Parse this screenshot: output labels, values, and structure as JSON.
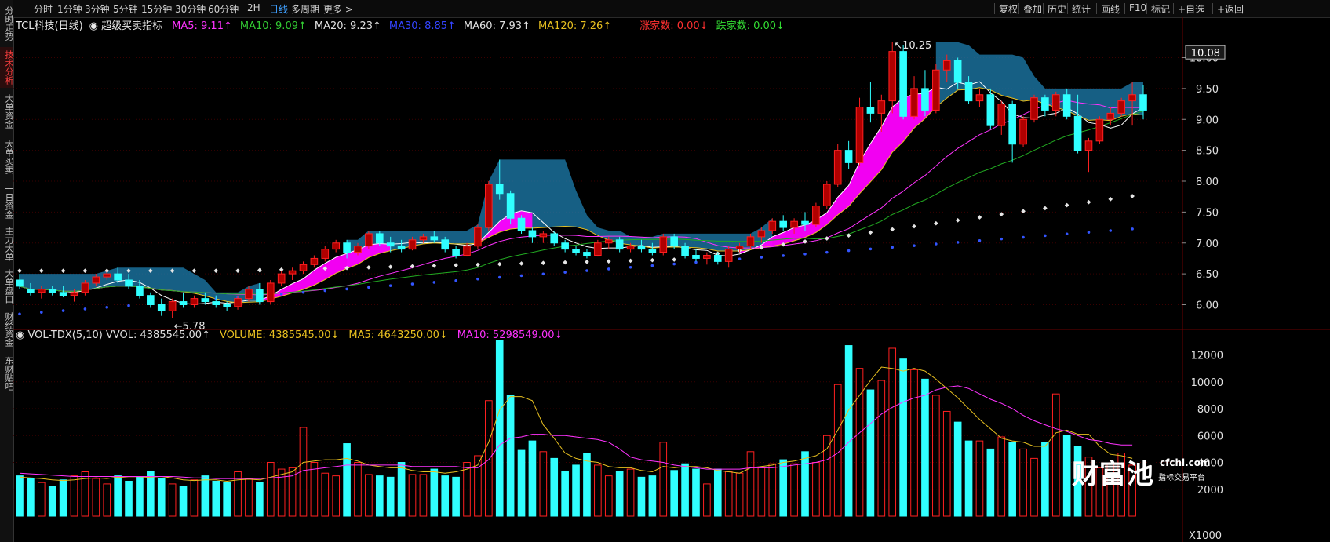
{
  "left_tabs": [
    {
      "label": "分时走势",
      "active": false
    },
    {
      "label": "技术分析",
      "active": true
    },
    {
      "label": "大单资金",
      "active": false
    },
    {
      "label": "大单买卖",
      "active": false
    },
    {
      "label": "一日资金",
      "active": false
    },
    {
      "label": "主力大单",
      "active": false
    },
    {
      "label": "大单盘口",
      "active": false
    },
    {
      "label": "财经资金",
      "active": false
    },
    {
      "label": "东财贴吧",
      "active": false
    }
  ],
  "periods": [
    "分时",
    "1分钟",
    "3分钟",
    "5分钟",
    "15分钟",
    "30分钟",
    "60分钟",
    "2H",
    "日线",
    "多周期",
    "更多 >"
  ],
  "active_period": "日线",
  "tools": [
    "复权",
    "叠加",
    "历史",
    "统计",
    "画线",
    "F10",
    "标记",
    "+自选",
    "+返回"
  ],
  "main_legend": {
    "title": "TCL科技(日线)",
    "indicator": "超级买卖指标",
    "items": [
      {
        "text": "MA5: 9.11↑",
        "color": "#ff33ff"
      },
      {
        "text": "MA10: 9.09↑",
        "color": "#33cc33"
      },
      {
        "text": "MA20: 9.23↑",
        "color": "#e0e0e0"
      },
      {
        "text": "MA30: 8.85↑",
        "color": "#3344ff"
      },
      {
        "text": "MA60: 7.93↑",
        "color": "#e0e0e0"
      },
      {
        "text": "MA120: 7.26↑",
        "color": "#e8c020"
      },
      {
        "text": "涨家数: 0.00↓",
        "color": "#ff3030"
      },
      {
        "text": "跌家数: 0.00↓",
        "color": "#33dd33"
      }
    ]
  },
  "vol_legend": {
    "items": [
      {
        "text": "VOL-TDX(5,10) VVOL: 4385545.00↑",
        "color": "#e0e0e0"
      },
      {
        "text": "VOLUME: 4385545.00↓",
        "color": "#e8c020"
      },
      {
        "text": "MA5: 4643250.00↓",
        "color": "#e8c020"
      },
      {
        "text": "MA10: 5298549.00↓",
        "color": "#ff33ff"
      }
    ]
  },
  "price_axis": {
    "ticks": [
      "10.00",
      "9.50",
      "9.00",
      "8.50",
      "8.00",
      "7.50",
      "7.00",
      "6.50",
      "6.00"
    ],
    "current": "10.08"
  },
  "vol_axis": {
    "ticks": [
      "12000",
      "10000",
      "8000",
      "6000",
      "4000",
      "2000"
    ],
    "unit": "X1000"
  },
  "watermark": {
    "main": "财富池",
    "domain": "cfchi.com",
    "sub": "指标交易平台"
  },
  "colors": {
    "up": "#ff2020",
    "down": "#30ffff",
    "bg": "#000000",
    "grid": "#3a0000",
    "cloud": "#1e7fb0",
    "band": "#ff00ff"
  },
  "chart_data": {
    "type": "candlestick",
    "ylim": [
      5.6,
      10.4
    ],
    "vol_ylim": [
      0,
      13200
    ],
    "high_label": "10.25",
    "low_label": "5.78",
    "candles": [
      [
        6.4,
        6.5,
        6.25,
        6.3
      ],
      [
        6.25,
        6.35,
        6.15,
        6.2
      ],
      [
        6.2,
        6.3,
        6.1,
        6.25
      ],
      [
        6.25,
        6.3,
        6.15,
        6.2
      ],
      [
        6.2,
        6.3,
        6.12,
        6.15
      ],
      [
        6.15,
        6.25,
        6.05,
        6.2
      ],
      [
        6.2,
        6.4,
        6.15,
        6.35
      ],
      [
        6.35,
        6.5,
        6.3,
        6.45
      ],
      [
        6.45,
        6.55,
        6.4,
        6.5
      ],
      [
        6.5,
        6.6,
        6.35,
        6.4
      ],
      [
        6.4,
        6.5,
        6.25,
        6.3
      ],
      [
        6.3,
        6.4,
        6.1,
        6.15
      ],
      [
        6.15,
        6.2,
        5.95,
        6.0
      ],
      [
        6.0,
        6.1,
        5.82,
        5.9
      ],
      [
        5.9,
        6.1,
        5.78,
        6.05
      ],
      [
        6.05,
        6.2,
        5.95,
        6.0
      ],
      [
        6.0,
        6.15,
        5.95,
        6.1
      ],
      [
        6.1,
        6.2,
        6.0,
        6.05
      ],
      [
        6.05,
        6.15,
        5.95,
        6.0
      ],
      [
        6.0,
        6.05,
        5.9,
        5.97
      ],
      [
        5.97,
        6.15,
        5.92,
        6.1
      ],
      [
        6.1,
        6.3,
        6.05,
        6.25
      ],
      [
        6.25,
        6.35,
        6.0,
        6.05
      ],
      [
        6.05,
        6.4,
        6.0,
        6.35
      ],
      [
        6.35,
        6.55,
        6.3,
        6.5
      ],
      [
        6.5,
        6.6,
        6.4,
        6.55
      ],
      [
        6.55,
        6.7,
        6.5,
        6.65
      ],
      [
        6.65,
        6.8,
        6.6,
        6.75
      ],
      [
        6.75,
        6.95,
        6.7,
        6.9
      ],
      [
        6.9,
        7.05,
        6.85,
        7.0
      ],
      [
        7.0,
        7.05,
        6.75,
        6.85
      ],
      [
        6.85,
        7.0,
        6.8,
        6.95
      ],
      [
        6.95,
        7.2,
        6.9,
        7.15
      ],
      [
        7.15,
        7.2,
        6.95,
        7.0
      ],
      [
        7.0,
        7.1,
        6.85,
        6.95
      ],
      [
        6.95,
        7.05,
        6.85,
        6.9
      ],
      [
        6.9,
        7.1,
        6.88,
        7.05
      ],
      [
        7.05,
        7.15,
        7.0,
        7.1
      ],
      [
        7.1,
        7.2,
        7.0,
        7.05
      ],
      [
        7.05,
        7.1,
        6.85,
        6.9
      ],
      [
        6.9,
        6.95,
        6.75,
        6.8
      ],
      [
        6.8,
        7.0,
        6.78,
        6.95
      ],
      [
        6.95,
        7.3,
        6.9,
        7.25
      ],
      [
        7.25,
        8.0,
        7.2,
        7.95
      ],
      [
        7.95,
        8.35,
        7.7,
        7.8
      ],
      [
        7.8,
        7.85,
        7.3,
        7.4
      ],
      [
        7.4,
        7.45,
        7.15,
        7.2
      ],
      [
        7.2,
        7.25,
        7.0,
        7.1
      ],
      [
        7.1,
        7.2,
        7.0,
        7.15
      ],
      [
        7.15,
        7.2,
        6.95,
        7.0
      ],
      [
        7.0,
        7.05,
        6.85,
        6.9
      ],
      [
        6.9,
        6.95,
        6.8,
        6.85
      ],
      [
        6.85,
        6.9,
        6.75,
        6.8
      ],
      [
        6.8,
        7.05,
        6.78,
        7.0
      ],
      [
        7.0,
        7.1,
        6.9,
        7.05
      ],
      [
        7.05,
        7.1,
        6.85,
        6.9
      ],
      [
        6.9,
        7.0,
        6.85,
        6.95
      ],
      [
        6.95,
        7.05,
        6.85,
        6.9
      ],
      [
        6.9,
        7.0,
        6.8,
        6.85
      ],
      [
        6.85,
        7.15,
        6.8,
        7.1
      ],
      [
        7.1,
        7.15,
        6.9,
        6.95
      ],
      [
        6.95,
        7.0,
        6.75,
        6.8
      ],
      [
        6.8,
        6.9,
        6.7,
        6.75
      ],
      [
        6.75,
        6.85,
        6.65,
        6.8
      ],
      [
        6.8,
        6.85,
        6.65,
        6.7
      ],
      [
        6.7,
        6.95,
        6.6,
        6.9
      ],
      [
        6.9,
        7.0,
        6.85,
        6.95
      ],
      [
        6.95,
        7.15,
        6.9,
        7.1
      ],
      [
        7.1,
        7.25,
        7.0,
        7.2
      ],
      [
        7.2,
        7.4,
        7.15,
        7.35
      ],
      [
        7.35,
        7.45,
        7.2,
        7.25
      ],
      [
        7.25,
        7.4,
        7.15,
        7.35
      ],
      [
        7.35,
        7.5,
        7.2,
        7.3
      ],
      [
        7.3,
        7.65,
        7.25,
        7.6
      ],
      [
        7.6,
        8.0,
        7.55,
        7.95
      ],
      [
        7.95,
        8.6,
        7.9,
        8.5
      ],
      [
        8.5,
        8.65,
        8.2,
        8.3
      ],
      [
        8.3,
        9.35,
        8.25,
        9.2
      ],
      [
        9.2,
        9.6,
        8.95,
        9.1
      ],
      [
        9.1,
        9.4,
        8.8,
        9.3
      ],
      [
        9.3,
        10.25,
        9.1,
        10.1
      ],
      [
        10.1,
        10.2,
        9.0,
        9.05
      ],
      [
        9.05,
        9.7,
        9.0,
        9.5
      ],
      [
        9.5,
        9.8,
        9.05,
        9.15
      ],
      [
        9.15,
        9.9,
        9.1,
        9.8
      ],
      [
        9.8,
        10.05,
        9.6,
        9.95
      ],
      [
        9.95,
        10.0,
        9.5,
        9.6
      ],
      [
        9.6,
        9.7,
        9.25,
        9.3
      ],
      [
        9.3,
        9.5,
        9.2,
        9.4
      ],
      [
        9.4,
        9.5,
        8.85,
        8.9
      ],
      [
        8.9,
        9.3,
        8.75,
        9.25
      ],
      [
        9.25,
        9.3,
        8.3,
        8.6
      ],
      [
        8.6,
        9.05,
        8.55,
        9.0
      ],
      [
        9.0,
        9.4,
        8.95,
        9.35
      ],
      [
        9.35,
        9.4,
        9.05,
        9.15
      ],
      [
        9.15,
        9.45,
        9.05,
        9.4
      ],
      [
        9.4,
        9.5,
        9.0,
        9.05
      ],
      [
        9.05,
        9.4,
        8.45,
        8.5
      ],
      [
        8.5,
        8.7,
        8.15,
        8.65
      ],
      [
        8.65,
        9.05,
        8.6,
        9.0
      ],
      [
        9.0,
        9.2,
        8.9,
        9.1
      ],
      [
        9.1,
        9.35,
        9.05,
        9.3
      ],
      [
        9.3,
        9.6,
        8.9,
        9.4
      ],
      [
        9.4,
        9.55,
        9.0,
        9.15
      ]
    ],
    "volumes": [
      3000,
      2800,
      2500,
      2200,
      2700,
      3000,
      3300,
      2800,
      2400,
      3000,
      2600,
      2900,
      3300,
      2800,
      2400,
      2200,
      2700,
      3000,
      2600,
      2500,
      3300,
      2800,
      2500,
      4000,
      3500,
      3600,
      6600,
      4000,
      3200,
      3000,
      5400,
      4000,
      3100,
      3000,
      2900,
      4000,
      3100,
      3100,
      3500,
      3000,
      2900,
      4000,
      4500,
      8600,
      13100,
      9000,
      4900,
      5600,
      4800,
      4300,
      3300,
      3800,
      4700,
      3800,
      3000,
      3300,
      3500,
      2900,
      3000,
      5500,
      3400,
      3900,
      3500,
      2400,
      3500,
      3300,
      3200,
      4800,
      3600,
      3900,
      4200,
      3900,
      4800,
      4000,
      6000,
      9800,
      12700,
      11000,
      9400,
      10100,
      12500,
      11700,
      10900,
      10200,
      9000,
      7800,
      7000,
      5600,
      5600,
      5000,
      5900,
      5500,
      5000,
      4300,
      5500,
      9100,
      6000,
      5200,
      4400,
      3600,
      3900,
      4700,
      3800
    ],
    "ma_vol_short": [
      2900,
      2850,
      2800,
      2700,
      2650,
      2700,
      2800,
      2850,
      2800,
      2900,
      2850,
      2850,
      2900,
      2950,
      2850,
      2700,
      2650,
      2700,
      2700,
      2600,
      2700,
      2750,
      2700,
      2900,
      3100,
      3300,
      4000,
      4100,
      4200,
      4200,
      4300,
      4100,
      3800,
      3700,
      3600,
      3600,
      3400,
      3300,
      3300,
      3200,
      3300,
      3500,
      3800,
      5500,
      7900,
      8900,
      8900,
      8600,
      6800,
      5800,
      4700,
      4300,
      4100,
      4000,
      3700,
      3600,
      3600,
      3400,
      3300,
      3700,
      3600,
      3700,
      3700,
      3600,
      3400,
      3300,
      3200,
      3600,
      3700,
      3800,
      4000,
      4100,
      4300,
      4500,
      5000,
      6400,
      7900,
      9000,
      10100,
      11100,
      11000,
      10800,
      11000,
      10800,
      10200,
      9500,
      8800,
      8000,
      7200,
      6500,
      5800,
      5600,
      5500,
      5200,
      5200,
      6200,
      6400,
      6100,
      6100,
      5200,
      4600,
      4500,
      4300
    ],
    "ma_vol_long": [
      3200,
      3150,
      3100,
      3050,
      3000,
      2950,
      2950,
      2950,
      2950,
      2950,
      2950,
      2950,
      2950,
      2950,
      2950,
      2900,
      2850,
      2850,
      2800,
      2800,
      2800,
      2800,
      2800,
      2850,
      2900,
      3000,
      3400,
      3500,
      3600,
      3700,
      3800,
      3800,
      3800,
      3800,
      3800,
      3800,
      3700,
      3700,
      3700,
      3700,
      3700,
      3600,
      3600,
      4200,
      5300,
      5800,
      5900,
      6100,
      6100,
      6000,
      6000,
      5900,
      5800,
      5700,
      5500,
      5000,
      4400,
      4200,
      4100,
      4000,
      3800,
      3700,
      3600,
      3500,
      3500,
      3500,
      3500,
      3600,
      3600,
      3600,
      3700,
      3800,
      3900,
      4000,
      4200,
      4700,
      5500,
      6200,
      6900,
      7600,
      8100,
      8500,
      8800,
      9000,
      9400,
      9600,
      9700,
      9500,
      9100,
      8700,
      8400,
      8000,
      7500,
      7100,
      6800,
      6500,
      6300,
      6000,
      5700,
      5600,
      5400,
      5300,
      5300
    ]
  }
}
